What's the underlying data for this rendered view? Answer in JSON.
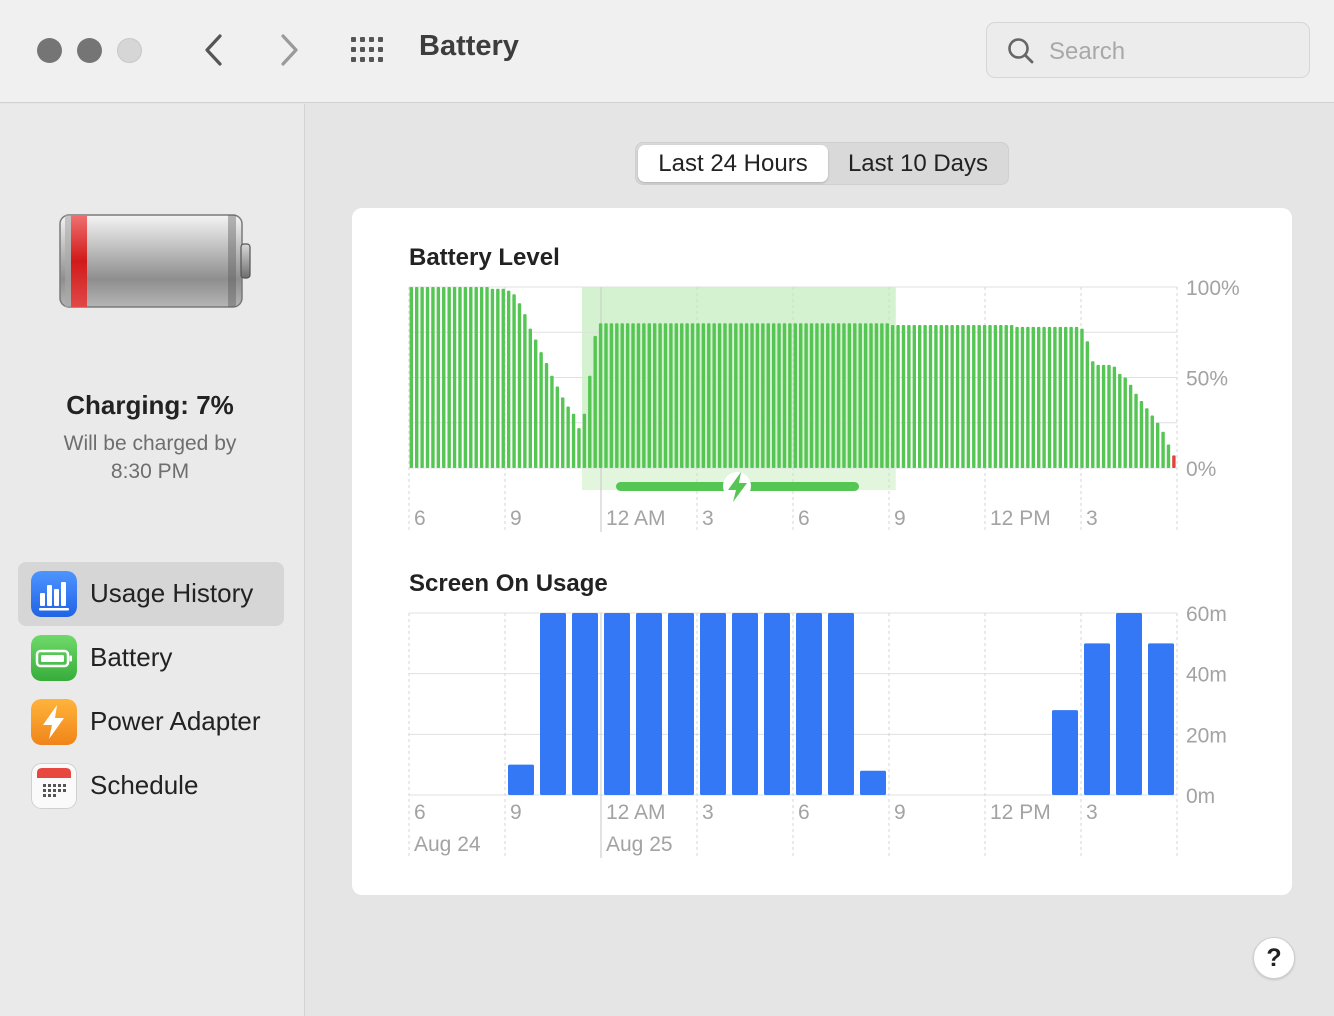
{
  "window": {
    "title": "Battery"
  },
  "search": {
    "placeholder": "Search"
  },
  "status": {
    "title": "Charging: 7%",
    "line1": "Will be charged by",
    "line2": "8:30 PM"
  },
  "sidebar": {
    "items": [
      {
        "label": "Usage History",
        "icon": "bar-chart-icon",
        "color": "#2f7cf6",
        "selected": true
      },
      {
        "label": "Battery",
        "icon": "battery-icon",
        "color": "#4fc24f",
        "selected": false
      },
      {
        "label": "Power Adapter",
        "icon": "lightning-icon",
        "color": "#f49c25",
        "selected": false
      },
      {
        "label": "Schedule",
        "icon": "calendar-icon",
        "color": "#ffffff",
        "selected": false
      }
    ]
  },
  "tabs": [
    {
      "label": "Last 24 Hours",
      "selected": true
    },
    {
      "label": "Last 10 Days",
      "selected": false
    }
  ],
  "help": {
    "label": "?"
  },
  "chart_data": [
    {
      "type": "bar",
      "title": "Battery Level",
      "x_tick_labels": [
        "6",
        "9",
        "12 AM",
        "3",
        "6",
        "9",
        "12 PM",
        "3"
      ],
      "y_tick_labels": [
        "100%",
        "50%",
        "0%"
      ],
      "ylim": [
        0,
        100
      ],
      "colors": {
        "normal": "#55c553",
        "low": "#e0443e",
        "charging_band": "#d4f2cf",
        "charging_bar": "#55c553"
      },
      "values": [
        100,
        100,
        100,
        100,
        100,
        100,
        100,
        100,
        100,
        100,
        100,
        100,
        100,
        100,
        100,
        99,
        99,
        99,
        98,
        96,
        91,
        85,
        77,
        71,
        64,
        58,
        51,
        45,
        39,
        34,
        30,
        22,
        30,
        51,
        73,
        80,
        80,
        80,
        80,
        80,
        80,
        80,
        80,
        80,
        80,
        80,
        80,
        80,
        80,
        80,
        80,
        80,
        80,
        80,
        80,
        80,
        80,
        80,
        80,
        80,
        80,
        80,
        80,
        80,
        80,
        80,
        80,
        80,
        80,
        80,
        80,
        80,
        80,
        80,
        80,
        80,
        80,
        80,
        80,
        80,
        80,
        80,
        80,
        80,
        80,
        80,
        80,
        80,
        80,
        79,
        79,
        79,
        79,
        79,
        79,
        79,
        79,
        79,
        79,
        79,
        79,
        79,
        79,
        79,
        79,
        79,
        79,
        79,
        79,
        79,
        79,
        79,
        78,
        78,
        78,
        78,
        78,
        78,
        78,
        78,
        78,
        78,
        78,
        78,
        77,
        70,
        59,
        57,
        57,
        57,
        56,
        52,
        50,
        46,
        41,
        37,
        33,
        29,
        25,
        20,
        13,
        7
      ],
      "charging_period": {
        "start_index": 32,
        "end_index": 89
      },
      "grid": true
    },
    {
      "type": "bar",
      "title": "Screen On Usage",
      "x_tick_labels": [
        "6",
        "9",
        "12 AM",
        "3",
        "6",
        "9",
        "12 PM",
        "3"
      ],
      "date_labels": [
        "Aug 24",
        "Aug 25"
      ],
      "y_tick_labels": [
        "60m",
        "40m",
        "20m",
        "0m"
      ],
      "ylim": [
        0,
        60
      ],
      "color": "#3478f6",
      "values": [
        0,
        0,
        0,
        10,
        60,
        60,
        60,
        60,
        60,
        60,
        60,
        60,
        60,
        60,
        8,
        0,
        0,
        0,
        0,
        0,
        28,
        50,
        60,
        50
      ],
      "grid": true
    }
  ]
}
